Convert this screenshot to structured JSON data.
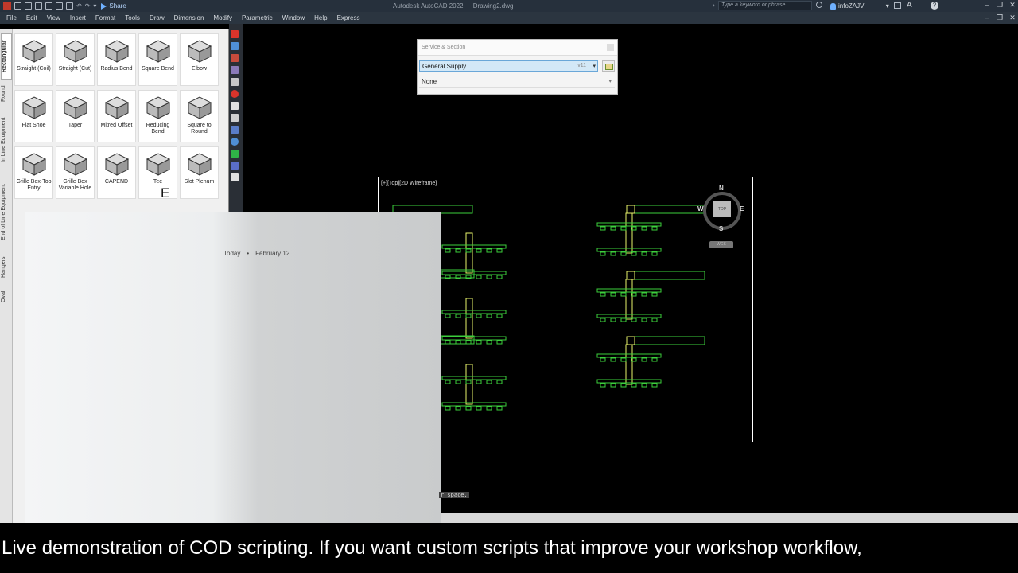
{
  "titlebar": {
    "app_name": "Autodesk AutoCAD 2022",
    "file_name": "Drawing2.dwg",
    "share_label": "Share",
    "search_placeholder": "Type a keyword or phrase",
    "user_name": "infoZAJVI"
  },
  "menu": [
    "File",
    "Edit",
    "View",
    "Insert",
    "Format",
    "Tools",
    "Draw",
    "Dimension",
    "Modify",
    "Parametric",
    "Window",
    "Help",
    "Express"
  ],
  "palette": {
    "tabs": [
      "Rectangular",
      "Round",
      "In Line Equipment",
      "End of Line Equipment",
      "Hangers",
      "Oval"
    ],
    "tools": [
      "Straight (Coil)",
      "Straight (Cut)",
      "Radius Bend",
      "Square Bend",
      "Elbow",
      "Flat Shoe",
      "Taper",
      "Mitred Offset",
      "Reducing Bend",
      "Square to Round",
      "Grille Box-Top Entry",
      "Grille Box Variable Hole",
      "CAPEND",
      "Tee",
      "Slot Plenum"
    ]
  },
  "service_dialog": {
    "title": "Service & Section",
    "service": "General Supply",
    "version": "v11",
    "section": "None"
  },
  "viewport": {
    "label": "[+][Top][2D Wireframe]",
    "compass": {
      "n": "N",
      "s": "S",
      "e": "E",
      "w": "W",
      "cube": "TOP",
      "wcs": "WCS"
    }
  },
  "overlay": {
    "day": "Today",
    "sep": "•",
    "date": "February 12"
  },
  "floating_letter": "E",
  "command_text": "r space.",
  "caption": "Live demonstration of COD scripting. If you want custom scripts that improve your workshop workflow,",
  "colors": {
    "duct": "#e8f36a",
    "duct_green": "#3ccf3c",
    "accent_blue": "#6fb1ff"
  }
}
